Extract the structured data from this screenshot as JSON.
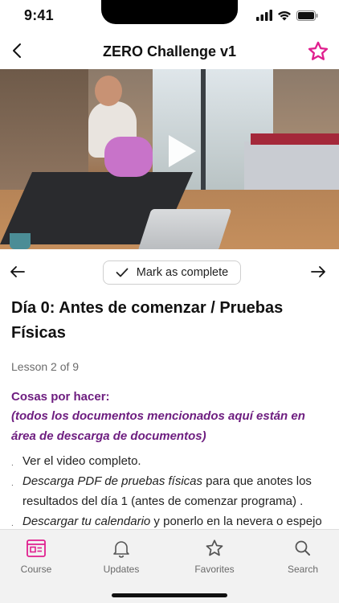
{
  "status_bar": {
    "time": "9:41",
    "icons": [
      "signal-icon",
      "wifi-icon",
      "battery-icon"
    ]
  },
  "nav": {
    "title": "ZERO Challenge v1",
    "back_icon": "chevron-left-icon",
    "favorite_icon": "star-outline-icon"
  },
  "video": {
    "play_icon": "play-icon"
  },
  "lesson_controls": {
    "prev_icon": "arrow-left-icon",
    "next_icon": "arrow-right-icon",
    "mark_complete_label": "Mark as complete",
    "check_icon": "check-icon"
  },
  "lesson": {
    "title": "Día 0: Antes de comenzar / Pruebas Físicas",
    "progress": "Lesson 2 of 9",
    "todo_heading": "Cosas por hacer:",
    "todo_subheading": "(todos los documentos mencionados aquí están en área de descarga de documentos)",
    "items": [
      {
        "italic": "",
        "text": "Ver el video completo."
      },
      {
        "italic": "Descarga PDF de pruebas físicas",
        "text": " para que anotes los resultados del día 1 (antes de comenzar programa) ."
      },
      {
        "italic": "Descargar tu calendario",
        "text": "  y ponerlo en la nevera o espejo del baño para que nunca se te olvide que"
      }
    ]
  },
  "tab_bar": {
    "tabs": [
      {
        "label": "Course",
        "icon": "course-icon",
        "active": true
      },
      {
        "label": "Updates",
        "icon": "bell-icon",
        "active": false
      },
      {
        "label": "Favorites",
        "icon": "star-icon",
        "active": false
      },
      {
        "label": "Search",
        "icon": "search-icon",
        "active": false
      }
    ]
  },
  "colors": {
    "accent": "#e0208f",
    "todo_purple": "#6e1e80",
    "tab_bar_bg": "#f2f2f2"
  }
}
